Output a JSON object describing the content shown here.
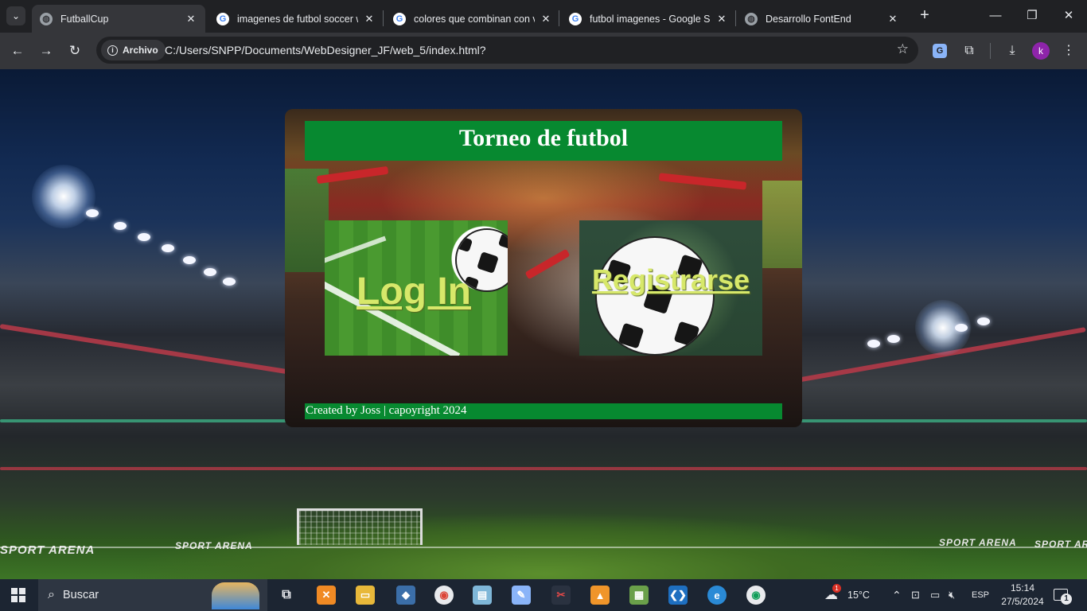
{
  "browser": {
    "tabs": [
      {
        "title": "FutballCup",
        "icon": "globe-icon",
        "active": true
      },
      {
        "title": "imagenes de futbol soccer w",
        "icon": "google-icon",
        "active": false
      },
      {
        "title": "colores que combinan con v",
        "icon": "google-icon",
        "active": false
      },
      {
        "title": "futbol imagenes - Google Se",
        "icon": "google-icon",
        "active": false
      },
      {
        "title": "Desarrollo FontEnd",
        "icon": "globe-icon",
        "active": false
      }
    ],
    "security_chip": "Archivo",
    "url": "C:/Users/SNPP/Documents/WebDesigner_JF/web_5/index.html?",
    "profile_initial": "k",
    "google_glyph": "G"
  },
  "page": {
    "title": "Torneo de futbol",
    "login_link": "Log In",
    "register_link": "Registrarse",
    "footer": "Created by Joss | capoyright 2024",
    "colors": {
      "header_bg": "#078930",
      "link": "#d7e86a"
    }
  },
  "taskbar": {
    "search_placeholder": "Buscar",
    "weather_temp": "15°C",
    "weather_badge": "1",
    "language": "ESP",
    "time": "15:14",
    "date": "27/5/2024",
    "notification_count": "1"
  }
}
